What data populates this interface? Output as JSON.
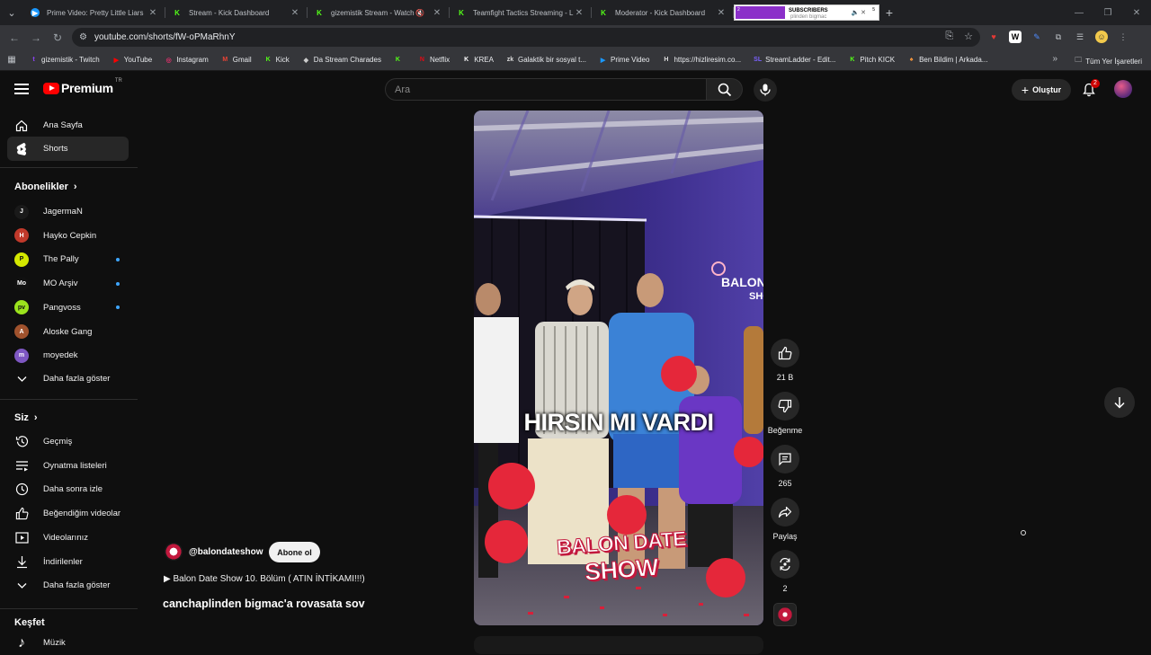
{
  "browser": {
    "tabs": [
      {
        "title": "Prime Video: Pretty Little Liars",
        "icon": "prime-video-icon",
        "color": "#1a98ff"
      },
      {
        "title": "Stream - Kick Dashboard",
        "icon": "kick-icon",
        "color": "#53fc18"
      },
      {
        "title": "gizemistik Stream - Watch",
        "icon": "kick-icon",
        "color": "#53fc18",
        "muted": true
      },
      {
        "title": "Teamfight Tactics Streaming - L",
        "icon": "kick-icon",
        "color": "#53fc18"
      },
      {
        "title": "Moderator - Kick Dashboard",
        "icon": "kick-icon",
        "color": "#53fc18"
      }
    ],
    "active_tab": {
      "label_left": "2",
      "label_mid": "SUBSCRIBERS",
      "label_right": "5",
      "subtitle": "plinden bigmac"
    },
    "url": "youtube.com/shorts/fW-oPMaRhnY",
    "bookmarks": [
      {
        "label": "gizemistik - Twitch",
        "color": "#9146ff",
        "glyph": "t"
      },
      {
        "label": "YouTube",
        "color": "#ff0000",
        "glyph": "▶"
      },
      {
        "label": "Instagram",
        "color": "#e1306c",
        "glyph": "◎"
      },
      {
        "label": "Gmail",
        "color": "#ea4335",
        "glyph": "M"
      },
      {
        "label": "Kick",
        "color": "#53fc18",
        "glyph": "K"
      },
      {
        "label": "Da Stream Charades",
        "color": "#cccccc",
        "glyph": "◆"
      },
      {
        "label": "",
        "color": "#53fc18",
        "glyph": "K"
      },
      {
        "label": "Netflix",
        "color": "#e50914",
        "glyph": "N"
      },
      {
        "label": "KREA",
        "color": "#ffffff",
        "glyph": "K"
      },
      {
        "label": "Galaktik bir sosyal t...",
        "color": "#dddddd",
        "glyph": "zk"
      },
      {
        "label": "Prime Video",
        "color": "#1a98ff",
        "glyph": "▶"
      },
      {
        "label": "https://hizliresim.co...",
        "color": "#dddddd",
        "glyph": "H"
      },
      {
        "label": "StreamLadder - Edit...",
        "color": "#7b61ff",
        "glyph": "SL"
      },
      {
        "label": "Pitch KICK",
        "color": "#53fc18",
        "glyph": "K"
      },
      {
        "label": "Ben Bildim | Arkada...",
        "color": "#ff9a3c",
        "glyph": "♠"
      }
    ],
    "all_bookmarks": "Tüm Yer İşaretleri"
  },
  "header": {
    "logo": "Premium",
    "logo_suffix": "TR",
    "search_placeholder": "Ara",
    "create_label": "Oluştur",
    "notification_count": "2"
  },
  "sidebar": {
    "main": [
      {
        "label": "Ana Sayfa",
        "icon": "home-icon"
      },
      {
        "label": "Shorts",
        "icon": "shorts-icon",
        "active": true
      }
    ],
    "subs_heading": "Abonelikler",
    "subscriptions": [
      {
        "label": "JagermaN",
        "color": "#1a1a1a",
        "glyph": "J",
        "dot": false
      },
      {
        "label": "Hayko Cepkin",
        "color": "#c0392b",
        "glyph": "H",
        "dot": false
      },
      {
        "label": "The Pally",
        "color": "#d4e800",
        "glyph": "P",
        "dot": true
      },
      {
        "label": "MO Arşiv",
        "color": "#111111",
        "glyph": "Mo",
        "dot": true
      },
      {
        "label": "Pangvoss",
        "color": "#9be31d",
        "glyph": "pv",
        "dot": true
      },
      {
        "label": "Aloske Gang",
        "color": "#a0522d",
        "glyph": "A",
        "dot": false
      },
      {
        "label": "moyedek",
        "color": "#7e57c2",
        "glyph": "m",
        "dot": false
      }
    ],
    "show_more_subs": "Daha fazla göster",
    "you_heading": "Siz",
    "you": [
      {
        "label": "Geçmiş",
        "icon": "history-icon"
      },
      {
        "label": "Oynatma listeleri",
        "icon": "playlists-icon"
      },
      {
        "label": "Daha sonra izle",
        "icon": "clock-icon"
      },
      {
        "label": "Beğendiğim videolar",
        "icon": "thumbs-up-icon"
      },
      {
        "label": "Videolarınız",
        "icon": "video-icon"
      },
      {
        "label": "İndirilenler",
        "icon": "download-icon"
      },
      {
        "label": "Daha fazla göster",
        "icon": "chevron-down-icon"
      }
    ],
    "explore_heading": "Keşfet",
    "explore": [
      {
        "label": "Müzik",
        "icon": "music-icon"
      }
    ]
  },
  "short": {
    "caption": "HIRSIN MI VARDI",
    "brand_line1": "BALON DATE",
    "brand_line2": "SHOW",
    "wall_sign": "BALON",
    "wall_sign2": "SHO",
    "channel_handle": "@balondateshow",
    "subscribe_label": "Abone ol",
    "music": "▶ Balon Date Show 10. Bölüm ( ATIN İNTİKAMI!!!)",
    "title": "canchaplinden bigmac'a rovasata sov"
  },
  "actions": {
    "likes": "21 B",
    "dislike_label": "Beğenme",
    "comments": "265",
    "share_label": "Paylaş",
    "remix_count": "2"
  },
  "colors": {
    "youtube_red": "#ff0000",
    "kick_green": "#53fc18",
    "accent_blue": "#3ea6ff"
  }
}
